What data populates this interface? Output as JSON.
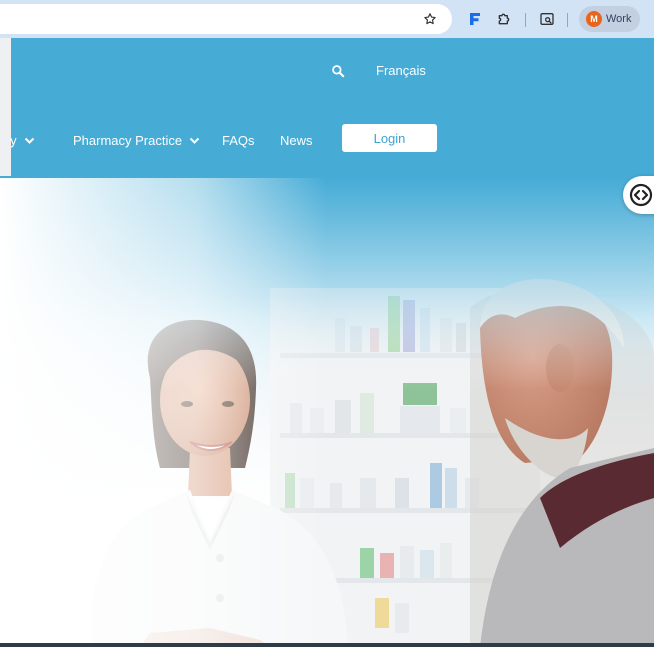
{
  "browser": {
    "bookmark_icon": "star-icon",
    "extension_icon": "f-extension-icon",
    "puzzle_icon": "puzzle-icon",
    "tab_search_icon": "tab-search-icon",
    "profile": {
      "initial": "M",
      "label": "Work",
      "avatar_color": "#e8651d"
    }
  },
  "header": {
    "search_icon": "search-icon",
    "language_link": "Français",
    "nav": [
      {
        "label": "ply",
        "has_dropdown": true
      },
      {
        "label": "Pharmacy Practice",
        "has_dropdown": true
      },
      {
        "label": "FAQs",
        "has_dropdown": false
      },
      {
        "label": "News",
        "has_dropdown": false
      }
    ],
    "login_label": "Login",
    "brand_color": "#46acd6"
  },
  "hero": {
    "image_subject": "pharmacist-with-customer-photo"
  },
  "accessibility_widget_icon": "code-toggle-icon"
}
